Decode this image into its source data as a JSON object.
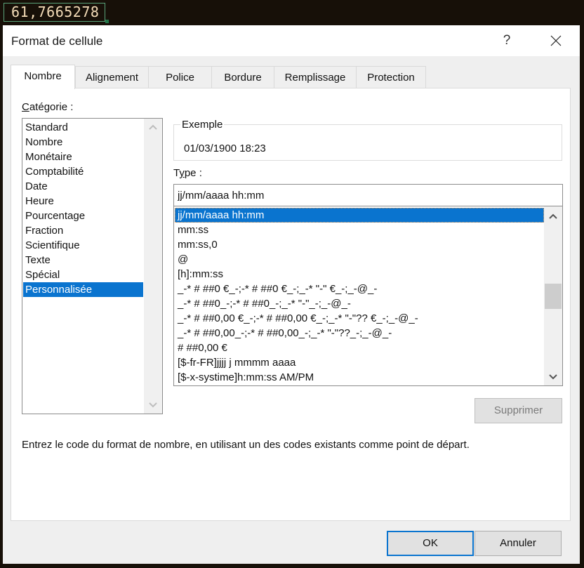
{
  "cell": {
    "value": "61,7665278"
  },
  "dialog": {
    "title": "Format de cellule",
    "help_label": "?",
    "close_icon": "close-icon"
  },
  "tabs": [
    {
      "label": "Nombre",
      "active": true
    },
    {
      "label": "Alignement",
      "active": false
    },
    {
      "label": "Police",
      "active": false
    },
    {
      "label": "Bordure",
      "active": false
    },
    {
      "label": "Remplissage",
      "active": false
    },
    {
      "label": "Protection",
      "active": false
    }
  ],
  "category": {
    "label_first": "C",
    "label_rest": "atégorie :",
    "items": [
      "Standard",
      "Nombre",
      "Monétaire",
      "Comptabilité",
      "Date",
      "Heure",
      "Pourcentage",
      "Fraction",
      "Scientifique",
      "Texte",
      "Spécial",
      "Personnalisée"
    ],
    "selected": "Personnalisée"
  },
  "example": {
    "legend": "Exemple",
    "value": "01/03/1900 18:23"
  },
  "type": {
    "label_first": "T",
    "label_mid": "y",
    "label_rest": "pe :",
    "input_value": "jj/mm/aaaa hh:mm",
    "items": [
      "jj/mm/aaaa hh:mm",
      "mm:ss",
      "mm:ss,0",
      "@",
      "[h]:mm:ss",
      "_-* # ##0 €_-;-* # ##0 €_-;_-* \"-\" €_-;_-@_-",
      "_-* # ##0_-;-* # ##0_-;_-* \"-\"_-;_-@_-",
      "_-* # ##0,00 €_-;-* # ##0,00 €_-;_-* \"-\"?? €_-;_-@_-",
      "_-* # ##0,00_-;-* # ##0,00_-;_-* \"-\"??_-;_-@_-",
      "# ##0,00 €",
      "[$-fr-FR]jjjj j mmmm aaaa",
      "[$-x-systime]h:mm:ss AM/PM"
    ],
    "selected": "jj/mm/aaaa hh:mm",
    "scroll_position_fraction": 0.75
  },
  "buttons": {
    "delete": "Supprimer",
    "ok": "OK",
    "cancel": "Annuler"
  },
  "hint": "Entrez le code du format de nombre, en utilisant un des codes existants comme point de départ.",
  "colors": {
    "selection": "#0a74cf",
    "dialog_bg": "#efefef",
    "backdrop": "#171008"
  }
}
